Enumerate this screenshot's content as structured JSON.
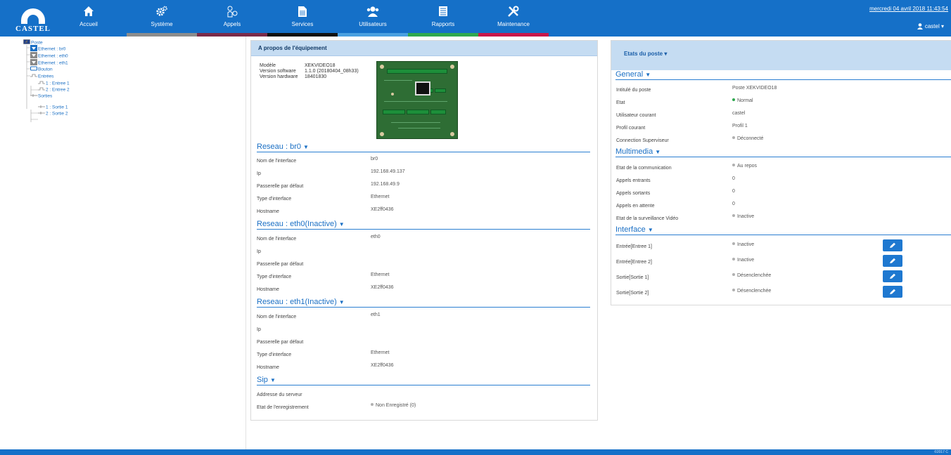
{
  "brand": {
    "logo_text": "CASTEL"
  },
  "nav": [
    {
      "label": "Accueil",
      "icon": "home-icon",
      "bar": "#1570c8"
    },
    {
      "label": "Système",
      "icon": "gears-icon",
      "bar": "#8c8c8c"
    },
    {
      "label": "Appels",
      "icon": "phone-icon",
      "bar": "#7a2b4a"
    },
    {
      "label": "Services",
      "icon": "document-icon",
      "bar": "#111111"
    },
    {
      "label": "Utilisateurs",
      "icon": "users-icon",
      "bar": "#4aa0e0"
    },
    {
      "label": "Rapports",
      "icon": "report-icon",
      "bar": "#2fa84f"
    },
    {
      "label": "Maintenance",
      "icon": "tools-icon",
      "bar": "#c8174b"
    }
  ],
  "header": {
    "datetime": "mercredi 04 avril 2018 11:43:54",
    "user": "castel"
  },
  "tree": {
    "root": "Poste",
    "items": [
      "Ethernet : br0",
      "Ethernet : eth0",
      "Ethernet : eth1",
      "Bouton",
      "Entrées",
      "1 : Entree 1",
      "2 : Entree 2",
      "Sorties",
      "1 : Sortie 1",
      "2 : Sortie 2"
    ]
  },
  "about": {
    "title": "A propos de l'équipement",
    "model_label": "Modèle",
    "model": "XEKVIDEO18",
    "software_label": "Version software",
    "software": "1.1.0 (20180404_08h33)",
    "hardware_label": "Version hardware",
    "hardware": "18401830"
  },
  "net_labels": {
    "iface": "Nom de l'interface",
    "ip": "Ip",
    "gateway": "Passerelle par défaut",
    "type": "Type d'interface",
    "hostname": "Hostname"
  },
  "networks": [
    {
      "title": "Reseau : br0",
      "iface": "br0",
      "ip": "192.168.49.137",
      "gateway": "192.168.49.9",
      "type": "Ethernet",
      "hostname": "XE2ff0436"
    },
    {
      "title": "Reseau : eth0(Inactive)",
      "iface": "eth0",
      "ip": "",
      "gateway": "",
      "type": "Ethernet",
      "hostname": "XE2ff0436"
    },
    {
      "title": "Reseau : eth1(Inactive)",
      "iface": "eth1",
      "ip": "",
      "gateway": "",
      "type": "Ethernet",
      "hostname": "XE2ff0436"
    }
  ],
  "sip": {
    "title": "Sip",
    "server_label": "Addresse du serveur",
    "server": "",
    "reg_label": "Etat de l'enregistrement",
    "reg": "Non Enregistré (0)"
  },
  "states": {
    "title": "Etats du poste",
    "general_title": "General",
    "general": [
      {
        "label": "Intitulé du poste",
        "value": "Poste XEKVIDEO18",
        "dot": ""
      },
      {
        "label": "Etat",
        "value": "Normal",
        "dot": "#2fa84f"
      },
      {
        "label": "Utilisateur courant",
        "value": "castel",
        "dot": ""
      },
      {
        "label": "Profil courant",
        "value": "Profil 1",
        "dot": ""
      },
      {
        "label": "Connection Superviseur",
        "value": "Déconnecté",
        "dot": "#b0b0b0"
      }
    ],
    "multimedia_title": "Multimedia",
    "multimedia": [
      {
        "label": "Etat de la communication",
        "value": "Au repos",
        "dot": "#b0b0b0"
      },
      {
        "label": "Appels entrants",
        "value": "0",
        "dot": ""
      },
      {
        "label": "Appels sortants",
        "value": "0",
        "dot": ""
      },
      {
        "label": "Appels en attente",
        "value": "0",
        "dot": ""
      },
      {
        "label": "Etat de la surveillance Vidéo",
        "value": "Inactive",
        "dot": "#b0b0b0"
      }
    ],
    "interface_title": "Interface",
    "interface": [
      {
        "label": "Entrée[Entree 1]",
        "value": "Inactive",
        "dot": "#b0b0b0"
      },
      {
        "label": "Entrée[Entree 2]",
        "value": "Inactive",
        "dot": "#b0b0b0"
      },
      {
        "label": "Sortie[Sortie 1]",
        "value": "Désenclenchée",
        "dot": "#b0b0b0"
      },
      {
        "label": "Sortie[Sortie 2]",
        "value": "Désenclenchée",
        "dot": "#b0b0b0"
      }
    ]
  },
  "footer": {
    "text": "©2017 C"
  }
}
